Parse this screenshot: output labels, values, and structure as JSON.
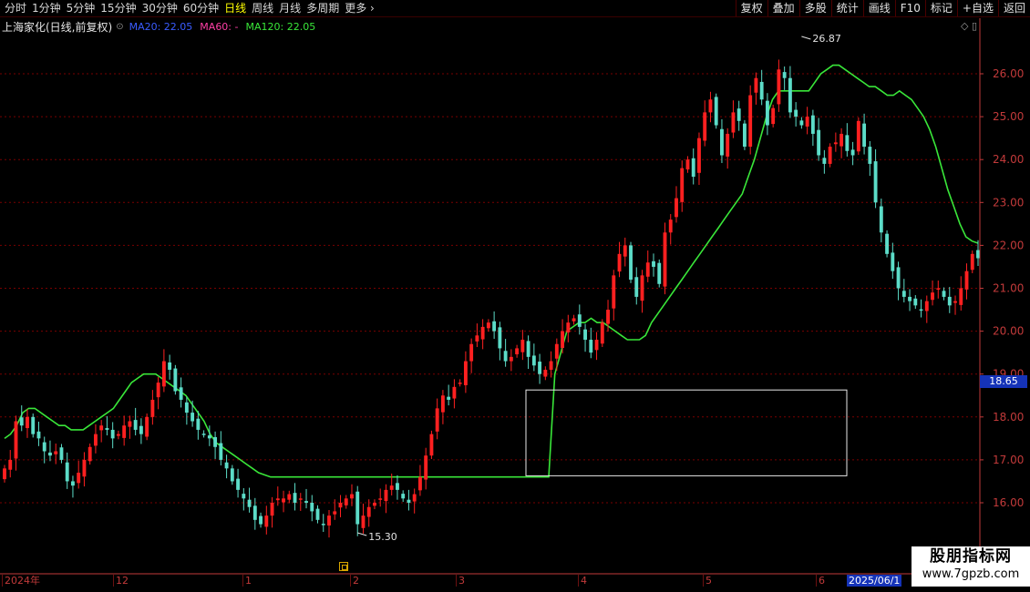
{
  "toolbar": {
    "period_tabs": [
      "分时",
      "1分钟",
      "5分钟",
      "15分钟",
      "30分钟",
      "60分钟",
      "日线",
      "周线",
      "月线",
      "多周期",
      "更多"
    ],
    "active_tab": "日线",
    "buttons": [
      "复权",
      "叠加",
      "多股",
      "统计",
      "画线",
      "F10",
      "标记",
      "+自选",
      "返回"
    ]
  },
  "header": {
    "stock_title": "上海家化(日线,前复权)",
    "ma20": "MA20: 22.05",
    "ma60": "MA60: -",
    "ma120": "MA120: 22.05",
    "icons": "◇ ▯"
  },
  "cursor_price": "18.65",
  "watermark": {
    "line1": "股朋指标网",
    "line2": "www.7gpzb.com"
  },
  "colors": {
    "up": "#ff2020",
    "down": "#5cdcc8",
    "ma20": "#3a5cff",
    "ma60": "#ff3fa6",
    "ma120": "#39e639",
    "grid": "#7a0000",
    "axis": "#c23a3a"
  },
  "chart_data": {
    "type": "candlestick",
    "title": "上海家化(日线,前复权)",
    "y_ticks": [
      "16.00",
      "17.00",
      "18.00",
      "19.00",
      "20.00",
      "21.00",
      "22.00",
      "23.00",
      "24.00",
      "25.00",
      "26.00"
    ],
    "ylim": [
      15.0,
      27.2
    ],
    "x_labels": [
      {
        "label": "2024年",
        "index": 0
      },
      {
        "label": "12",
        "index": 21
      },
      {
        "label": "1",
        "index": 44
      },
      {
        "label": "2",
        "index": 64
      },
      {
        "label": "3",
        "index": 84
      },
      {
        "label": "4",
        "index": 105
      },
      {
        "label": "5",
        "index": 128
      },
      {
        "label": "6",
        "index": 149
      },
      {
        "label": "2025/06/1",
        "index": 154
      }
    ],
    "annotations": [
      {
        "text": "26.87",
        "index": 140,
        "value": 26.87,
        "kind": "high"
      },
      {
        "text": "15.30",
        "index": 62,
        "value": 15.3,
        "kind": "low"
      }
    ],
    "selection_box": {
      "x_from_index": 96,
      "x_to_index": 155,
      "y_from": 18.65,
      "y_to": 16.65
    },
    "series": [
      {
        "name": "MA20",
        "values": [
          22.05
        ]
      },
      {
        "name": "MA60",
        "values": []
      },
      {
        "name": "MA120",
        "values": [
          22.05
        ]
      }
    ],
    "closes": [
      16.8,
      17.0,
      17.9,
      17.8,
      18.0,
      17.6,
      17.5,
      17.2,
      17.1,
      17.2,
      17.0,
      16.5,
      16.4,
      16.7,
      17.0,
      17.3,
      17.6,
      17.8,
      17.7,
      17.5,
      17.6,
      17.8,
      17.9,
      17.7,
      17.6,
      18.0,
      18.4,
      18.8,
      19.3,
      19.1,
      18.6,
      18.4,
      18.1,
      17.9,
      17.7,
      17.6,
      17.5,
      17.3,
      17.0,
      16.8,
      16.5,
      16.3,
      16.1,
      15.9,
      15.6,
      15.5,
      15.7,
      16.0,
      16.1,
      16.1,
      16.2,
      16.0,
      16.1,
      16.0,
      15.8,
      15.6,
      15.5,
      15.7,
      15.8,
      16.0,
      16.1,
      16.2,
      15.5,
      15.7,
      15.9,
      16.0,
      16.1,
      16.3,
      16.4,
      16.3,
      16.1,
      16.0,
      16.2,
      16.6,
      17.1,
      17.6,
      18.2,
      18.5,
      18.4,
      18.7,
      18.8,
      19.3,
      19.7,
      19.9,
      20.1,
      20.2,
      20.0,
      19.6,
      19.3,
      19.4,
      19.6,
      19.8,
      19.4,
      19.2,
      19.0,
      19.1,
      19.3,
      19.7,
      20.0,
      20.2,
      20.3,
      20.1,
      19.8,
      19.5,
      19.8,
      20.2,
      20.5,
      21.3,
      21.8,
      22.0,
      21.2,
      20.8,
      21.3,
      21.6,
      21.5,
      21.1,
      22.3,
      22.6,
      23.1,
      23.8,
      24.0,
      23.6,
      24.5,
      25.1,
      25.4,
      24.8,
      24.1,
      24.6,
      25.1,
      24.9,
      24.3,
      25.5,
      25.9,
      25.4,
      24.8,
      25.2,
      26.1,
      25.9,
      25.1,
      25.0,
      24.8,
      25.0,
      24.6,
      24.1,
      23.9,
      24.3,
      24.4,
      24.6,
      24.2,
      24.1,
      24.9,
      24.3,
      23.9,
      23.0,
      22.3,
      21.8,
      21.4,
      21.0,
      20.8,
      20.7,
      20.6,
      20.5,
      20.7,
      20.9,
      21.0,
      20.8,
      20.6,
      20.7,
      21.0,
      21.4,
      21.8,
      21.7
    ],
    "ma120_values": [
      17.5,
      17.6,
      17.8,
      18.1,
      18.2,
      18.2,
      18.1,
      18.0,
      17.9,
      17.8,
      17.8,
      17.7,
      17.7,
      17.7,
      17.8,
      17.9,
      18.0,
      18.1,
      18.2,
      18.4,
      18.6,
      18.8,
      18.9,
      19.0,
      19.0,
      19.0,
      18.9,
      18.8,
      18.7,
      18.6,
      18.5,
      18.3,
      18.1,
      17.9,
      17.6,
      17.4,
      17.3,
      17.2,
      17.1,
      17.0,
      16.9,
      16.8,
      16.7,
      16.65,
      16.6,
      16.6,
      16.6,
      16.6,
      16.6,
      16.6,
      16.6,
      16.6,
      16.6,
      16.6,
      16.6,
      16.6,
      16.6,
      16.6,
      16.6,
      16.6,
      16.6,
      16.6,
      16.6,
      16.6,
      16.6,
      16.6,
      16.6,
      16.6,
      16.6,
      16.6,
      16.6,
      16.6,
      16.6,
      16.6,
      16.6,
      16.6,
      16.6,
      16.6,
      16.6,
      16.6,
      16.6,
      16.6,
      16.6,
      16.6,
      16.6,
      16.6,
      16.6,
      16.6,
      16.6,
      16.6,
      16.6,
      19.0,
      19.5,
      20.0,
      20.1,
      20.2,
      20.2,
      20.3,
      20.2,
      20.2,
      20.1,
      20.0,
      19.9,
      19.8,
      19.8,
      19.8,
      19.9,
      20.2,
      20.4,
      20.6,
      20.8,
      21.0,
      21.2,
      21.4,
      21.6,
      21.8,
      22.0,
      22.2,
      22.4,
      22.6,
      22.8,
      23.0,
      23.2,
      23.6,
      24.0,
      24.5,
      25.0,
      25.4,
      25.6,
      25.6,
      25.6,
      25.6,
      25.6,
      25.6,
      25.8,
      26.0,
      26.1,
      26.2,
      26.2,
      26.1,
      26.0,
      25.9,
      25.8,
      25.7,
      25.7,
      25.6,
      25.5,
      25.5,
      25.6,
      25.5,
      25.4,
      25.2,
      25.0,
      24.7,
      24.3,
      23.8,
      23.3,
      22.9,
      22.5,
      22.2,
      22.1,
      22.05
    ]
  }
}
